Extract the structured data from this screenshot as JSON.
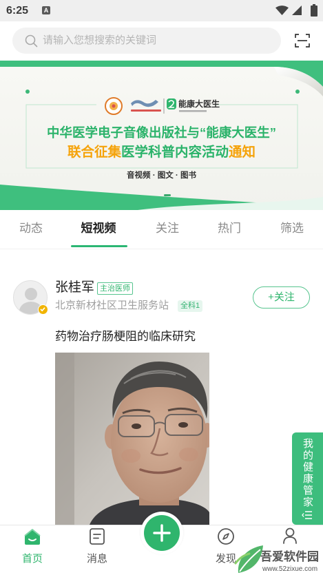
{
  "status_bar": {
    "time": "6:25",
    "notification_badge": "A",
    "icons": [
      "wifi-icon",
      "signal-icon",
      "battery-icon"
    ]
  },
  "search": {
    "placeholder": "请输入您想搜索的关键词",
    "icon": "search-icon",
    "scan_icon": "scan-icon"
  },
  "banner": {
    "partner_logo_text": "能康大医生",
    "headline_line1": "中华医学电子音像出版社与“能康大医生”",
    "headline_line1_color": "#2bb36a",
    "headline_line2": [
      {
        "text": "联合征集",
        "color": "#f5a30b"
      },
      {
        "text": "医学科普内容活动",
        "color": "#2bb36a"
      },
      {
        "text": "通知",
        "color": "#f5a30b"
      }
    ],
    "subline": "音视频 · 图文 · 图书",
    "background_color": "#3fbf7e"
  },
  "tabs": [
    {
      "label": "动态",
      "selected": false
    },
    {
      "label": "短视频",
      "selected": true
    },
    {
      "label": "关注",
      "selected": false
    },
    {
      "label": "热门",
      "selected": false
    },
    {
      "label": "筛选",
      "selected": false
    }
  ],
  "post": {
    "author_name": "张桂军",
    "author_title": "主治医师",
    "author_org": "北京新材社区卫生服务站",
    "department_tag": "全科1",
    "verified_icon": "verified-badge-icon",
    "follow_label": "+关注",
    "title": "药物治疗肠梗阻的临床研究"
  },
  "side_tab": {
    "label": "我的健康管家",
    "icon": "menu-icon"
  },
  "bottom_nav": {
    "items": [
      {
        "label": "首页",
        "icon": "home-icon",
        "active": true
      },
      {
        "label": "消息",
        "icon": "message-icon",
        "active": false
      },
      {
        "icon": "plus-icon",
        "active": false
      },
      {
        "label": "发现",
        "icon": "compass-icon",
        "active": false
      },
      {
        "icon": "person-icon",
        "active": false
      }
    ]
  },
  "watermark": {
    "name": "吾爱软件园",
    "url": "www.52zixue.com"
  },
  "colors": {
    "accent": "#2fb56d",
    "text_primary": "#222222",
    "text_secondary": "#9e9e9e",
    "tab_inactive": "#8a8a8a",
    "search_bg": "#f2f2f2",
    "status_bar_bg": "#efefef"
  }
}
